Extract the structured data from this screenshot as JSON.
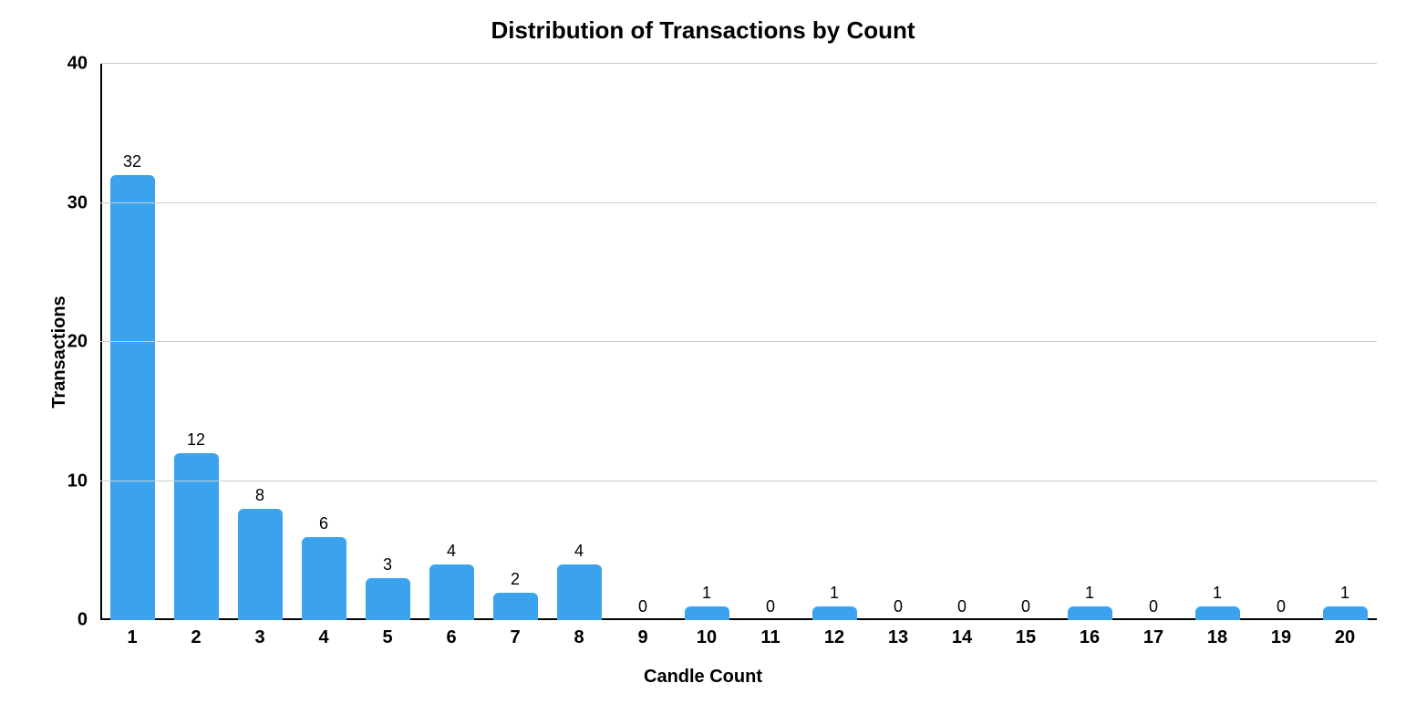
{
  "chart_data": {
    "type": "bar",
    "title": "Distribution of Transactions by Count",
    "xlabel": "Candle Count",
    "ylabel": "Transactions",
    "categories": [
      "1",
      "2",
      "3",
      "4",
      "5",
      "6",
      "7",
      "8",
      "9",
      "10",
      "11",
      "12",
      "13",
      "14",
      "15",
      "16",
      "17",
      "18",
      "19",
      "20"
    ],
    "values": [
      32,
      12,
      8,
      6,
      3,
      4,
      2,
      4,
      0,
      1,
      0,
      1,
      0,
      0,
      0,
      1,
      0,
      1,
      0,
      1
    ],
    "ylim": [
      0,
      40
    ],
    "yticks": [
      0,
      10,
      20,
      30,
      40
    ],
    "bar_color": "#3ba3ee"
  }
}
